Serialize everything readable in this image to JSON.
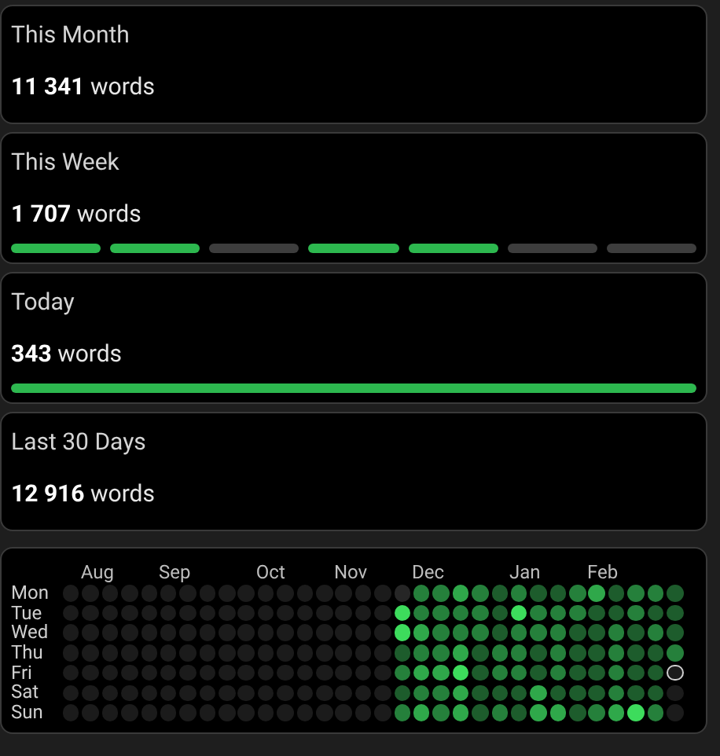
{
  "stats": [
    {
      "kind": "plain",
      "title": "This Month",
      "count": "11 341",
      "unit": "words"
    },
    {
      "kind": "segments",
      "title": "This Week",
      "count": "1 707",
      "unit": "words",
      "segments": [
        {
          "done": true
        },
        {
          "done": true
        },
        {
          "done": false
        },
        {
          "done": true
        },
        {
          "done": true
        },
        {
          "done": false
        },
        {
          "done": false
        }
      ]
    },
    {
      "kind": "bar",
      "title": "Today",
      "count": "343",
      "unit": "words",
      "level": 1
    },
    {
      "kind": "plain",
      "title": "Last 30 Days",
      "count": "12 916",
      "unit": "words"
    }
  ],
  "heatmap": {
    "days": [
      "Mon",
      "Tue",
      "Wed",
      "Thu",
      "Fri",
      "Sat",
      "Sun"
    ],
    "weeks": [
      {
        "cells": [
          {
            "color": "#1b1b1b"
          },
          {
            "color": "#1b1b1b"
          },
          {
            "color": "#1b1b1b"
          },
          {
            "color": "#1b1b1b"
          },
          {
            "color": "#1b1b1b"
          },
          {
            "color": "#1b1b1b"
          },
          {
            "color": "#1b1b1b"
          }
        ]
      },
      {
        "month": "Aug",
        "cells": [
          {
            "color": "#1b1b1b"
          },
          {
            "color": "#1b1b1b"
          },
          {
            "color": "#1b1b1b"
          },
          {
            "color": "#1b1b1b"
          },
          {
            "color": "#1b1b1b"
          },
          {
            "color": "#1b1b1b"
          },
          {
            "color": "#1b1b1b"
          }
        ]
      },
      {
        "cells": [
          {
            "color": "#1b1b1b"
          },
          {
            "color": "#1b1b1b"
          },
          {
            "color": "#1b1b1b"
          },
          {
            "color": "#1b1b1b"
          },
          {
            "color": "#1b1b1b"
          },
          {
            "color": "#1b1b1b"
          },
          {
            "color": "#1b1b1b"
          }
        ]
      },
      {
        "cells": [
          {
            "color": "#1b1b1b"
          },
          {
            "color": "#1b1b1b"
          },
          {
            "color": "#1b1b1b"
          },
          {
            "color": "#1b1b1b"
          },
          {
            "color": "#1b1b1b"
          },
          {
            "color": "#1b1b1b"
          },
          {
            "color": "#1b1b1b"
          }
        ]
      },
      {
        "cells": [
          {
            "color": "#1b1b1b"
          },
          {
            "color": "#1b1b1b"
          },
          {
            "color": "#1b1b1b"
          },
          {
            "color": "#1b1b1b"
          },
          {
            "color": "#1b1b1b"
          },
          {
            "color": "#1b1b1b"
          },
          {
            "color": "#1b1b1b"
          }
        ]
      },
      {
        "month": "Sep",
        "cells": [
          {
            "color": "#1b1b1b"
          },
          {
            "color": "#1b1b1b"
          },
          {
            "color": "#1b1b1b"
          },
          {
            "color": "#1b1b1b"
          },
          {
            "color": "#1b1b1b"
          },
          {
            "color": "#1b1b1b"
          },
          {
            "color": "#1b1b1b"
          }
        ]
      },
      {
        "cells": [
          {
            "color": "#1b1b1b"
          },
          {
            "color": "#1b1b1b"
          },
          {
            "color": "#1b1b1b"
          },
          {
            "color": "#1b1b1b"
          },
          {
            "color": "#1b1b1b"
          },
          {
            "color": "#1b1b1b"
          },
          {
            "color": "#1b1b1b"
          }
        ]
      },
      {
        "cells": [
          {
            "color": "#1b1b1b"
          },
          {
            "color": "#1b1b1b"
          },
          {
            "color": "#1b1b1b"
          },
          {
            "color": "#1b1b1b"
          },
          {
            "color": "#1b1b1b"
          },
          {
            "color": "#1b1b1b"
          },
          {
            "color": "#1b1b1b"
          }
        ]
      },
      {
        "cells": [
          {
            "color": "#1b1b1b"
          },
          {
            "color": "#1b1b1b"
          },
          {
            "color": "#1b1b1b"
          },
          {
            "color": "#1b1b1b"
          },
          {
            "color": "#1b1b1b"
          },
          {
            "color": "#1b1b1b"
          },
          {
            "color": "#1b1b1b"
          }
        ]
      },
      {
        "cells": [
          {
            "color": "#1b1b1b"
          },
          {
            "color": "#1b1b1b"
          },
          {
            "color": "#1b1b1b"
          },
          {
            "color": "#1b1b1b"
          },
          {
            "color": "#1b1b1b"
          },
          {
            "color": "#1b1b1b"
          },
          {
            "color": "#1b1b1b"
          }
        ]
      },
      {
        "month": "Oct",
        "cells": [
          {
            "color": "#1b1b1b"
          },
          {
            "color": "#1b1b1b"
          },
          {
            "color": "#1b1b1b"
          },
          {
            "color": "#1b1b1b"
          },
          {
            "color": "#1b1b1b"
          },
          {
            "color": "#1b1b1b"
          },
          {
            "color": "#1b1b1b"
          }
        ]
      },
      {
        "cells": [
          {
            "color": "#1b1b1b"
          },
          {
            "color": "#1b1b1b"
          },
          {
            "color": "#1b1b1b"
          },
          {
            "color": "#1b1b1b"
          },
          {
            "color": "#1b1b1b"
          },
          {
            "color": "#1b1b1b"
          },
          {
            "color": "#1b1b1b"
          }
        ]
      },
      {
        "cells": [
          {
            "color": "#1b1b1b"
          },
          {
            "color": "#1b1b1b"
          },
          {
            "color": "#1b1b1b"
          },
          {
            "color": "#1b1b1b"
          },
          {
            "color": "#1b1b1b"
          },
          {
            "color": "#1b1b1b"
          },
          {
            "color": "#1b1b1b"
          }
        ]
      },
      {
        "cells": [
          {
            "color": "#1b1b1b"
          },
          {
            "color": "#1b1b1b"
          },
          {
            "color": "#1b1b1b"
          },
          {
            "color": "#1b1b1b"
          },
          {
            "color": "#1b1b1b"
          },
          {
            "color": "#1b1b1b"
          },
          {
            "color": "#1b1b1b"
          }
        ]
      },
      {
        "month": "Nov",
        "cells": [
          {
            "color": "#1b1b1b"
          },
          {
            "color": "#1b1b1b"
          },
          {
            "color": "#1b1b1b"
          },
          {
            "color": "#1b1b1b"
          },
          {
            "color": "#1b1b1b"
          },
          {
            "color": "#1b1b1b"
          },
          {
            "color": "#1b1b1b"
          }
        ]
      },
      {
        "cells": [
          {
            "color": "#1b1b1b"
          },
          {
            "color": "#1b1b1b"
          },
          {
            "color": "#1b1b1b"
          },
          {
            "color": "#1b1b1b"
          },
          {
            "color": "#1b1b1b"
          },
          {
            "color": "#1b1b1b"
          },
          {
            "color": "#1b1b1b"
          }
        ]
      },
      {
        "cells": [
          {
            "color": "#1b1b1b"
          },
          {
            "color": "#1b1b1b"
          },
          {
            "color": "#1b1b1b"
          },
          {
            "color": "#1b1b1b"
          },
          {
            "color": "#1b1b1b"
          },
          {
            "color": "#1b1b1b"
          },
          {
            "color": "#1b1b1b"
          }
        ]
      },
      {
        "cells": [
          {
            "color": "#262626"
          },
          {
            "color": "#3ddc5c"
          },
          {
            "color": "#3ddc5c"
          },
          {
            "color": "#1d5c2c"
          },
          {
            "color": "#25803b"
          },
          {
            "color": "#1d5c2c"
          },
          {
            "color": "#25803b"
          }
        ]
      },
      {
        "month": "Dec",
        "cells": [
          {
            "color": "#25803b"
          },
          {
            "color": "#25803b"
          },
          {
            "color": "#2fa84a"
          },
          {
            "color": "#25803b"
          },
          {
            "color": "#2fa84a"
          },
          {
            "color": "#25803b"
          },
          {
            "color": "#2fa84a"
          }
        ]
      },
      {
        "cells": [
          {
            "color": "#25803b"
          },
          {
            "color": "#25803b"
          },
          {
            "color": "#25803b"
          },
          {
            "color": "#25803b"
          },
          {
            "color": "#2fa84a"
          },
          {
            "color": "#25803b"
          },
          {
            "color": "#25803b"
          }
        ]
      },
      {
        "cells": [
          {
            "color": "#2fa84a"
          },
          {
            "color": "#25803b"
          },
          {
            "color": "#25803b"
          },
          {
            "color": "#2fa84a"
          },
          {
            "color": "#3ddc5c"
          },
          {
            "color": "#2fa84a"
          },
          {
            "color": "#2fa84a"
          }
        ]
      },
      {
        "cells": [
          {
            "color": "#25803b"
          },
          {
            "color": "#25803b"
          },
          {
            "color": "#25803b"
          },
          {
            "color": "#1d5c2c"
          },
          {
            "color": "#1d5c2c"
          },
          {
            "color": "#1d5c2c"
          },
          {
            "color": "#1d5c2c"
          }
        ]
      },
      {
        "cells": [
          {
            "color": "#1d5c2c"
          },
          {
            "color": "#1d5c2c"
          },
          {
            "color": "#1d5c2c"
          },
          {
            "color": "#25803b"
          },
          {
            "color": "#25803b"
          },
          {
            "color": "#1d5c2c"
          },
          {
            "color": "#25803b"
          }
        ]
      },
      {
        "month": "Jan",
        "cells": [
          {
            "color": "#25803b"
          },
          {
            "color": "#3ddc5c"
          },
          {
            "color": "#25803b"
          },
          {
            "color": "#25803b"
          },
          {
            "color": "#25803b"
          },
          {
            "color": "#1d5c2c"
          },
          {
            "color": "#1d5c2c"
          }
        ]
      },
      {
        "cells": [
          {
            "color": "#1d5c2c"
          },
          {
            "color": "#25803b"
          },
          {
            "color": "#25803b"
          },
          {
            "color": "#1d5c2c"
          },
          {
            "color": "#1d5c2c"
          },
          {
            "color": "#2fa84a"
          },
          {
            "color": "#2fa84a"
          }
        ]
      },
      {
        "cells": [
          {
            "color": "#1d5c2c"
          },
          {
            "color": "#25803b"
          },
          {
            "color": "#25803b"
          },
          {
            "color": "#25803b"
          },
          {
            "color": "#25803b"
          },
          {
            "color": "#1d5c2c"
          },
          {
            "color": "#2fa84a"
          }
        ]
      },
      {
        "cells": [
          {
            "color": "#25803b"
          },
          {
            "color": "#25803b"
          },
          {
            "color": "#1d5c2c"
          },
          {
            "color": "#1d5c2c"
          },
          {
            "color": "#1d5c2c"
          },
          {
            "color": "#1d5c2c"
          },
          {
            "color": "#1d5c2c"
          }
        ]
      },
      {
        "month": "Feb",
        "cells": [
          {
            "color": "#2fa84a"
          },
          {
            "color": "#1d5c2c"
          },
          {
            "color": "#1d5c2c"
          },
          {
            "color": "#1d5c2c"
          },
          {
            "color": "#1d5c2c"
          },
          {
            "color": "#1d5c2c"
          },
          {
            "color": "#25803b"
          }
        ]
      },
      {
        "cells": [
          {
            "color": "#1d5c2c"
          },
          {
            "color": "#1d5c2c"
          },
          {
            "color": "#25803b"
          },
          {
            "color": "#25803b"
          },
          {
            "color": "#25803b"
          },
          {
            "color": "#25803b"
          },
          {
            "color": "#2fa84a"
          }
        ]
      },
      {
        "cells": [
          {
            "color": "#25803b"
          },
          {
            "color": "#25803b"
          },
          {
            "color": "#1d5c2c"
          },
          {
            "color": "#1d5c2c"
          },
          {
            "color": "#1d5c2c"
          },
          {
            "color": "#1d5c2c"
          },
          {
            "color": "#3ddc5c"
          }
        ]
      },
      {
        "cells": [
          {
            "color": "#25803b"
          },
          {
            "color": "#1d5c2c"
          },
          {
            "color": "#25803b"
          },
          {
            "color": "#1d5c2c"
          },
          {
            "color": "#1d5c2c"
          },
          {
            "color": "#1d5c2c"
          },
          {
            "color": "#25803b"
          }
        ]
      },
      {
        "cells": [
          {
            "color": "#1d5c2c"
          },
          {
            "color": "#1d5c2c"
          },
          {
            "color": "#1d5c2c"
          },
          {
            "color": "#25803b"
          },
          {
            "color": "#1b1b1b",
            "today": true
          },
          {
            "color": "#1b1b1b"
          },
          {
            "color": "#1b1b1b"
          }
        ]
      }
    ]
  }
}
